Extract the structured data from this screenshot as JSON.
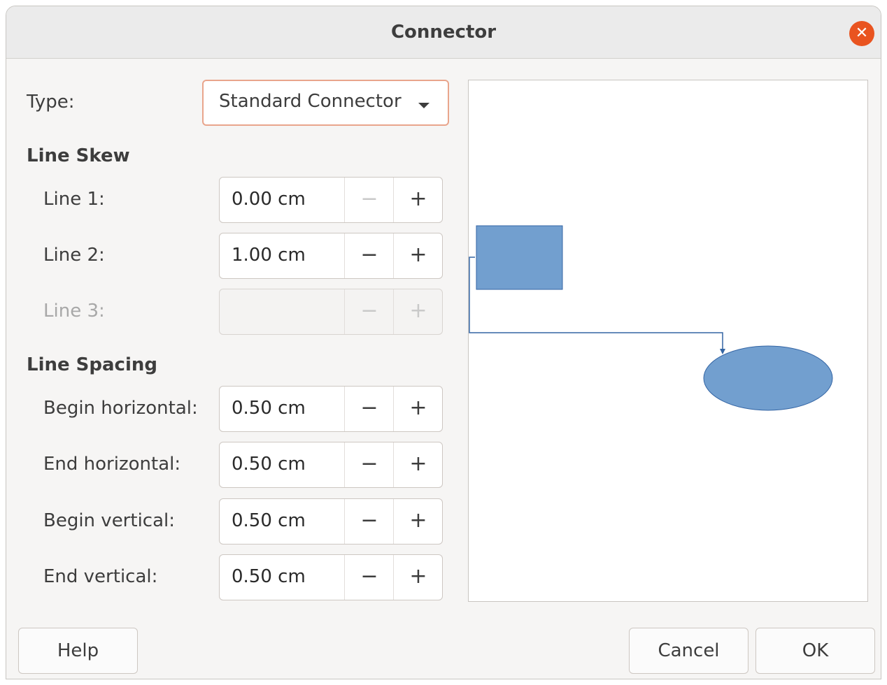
{
  "dialog": {
    "title": "Connector",
    "close_icon": "close-icon"
  },
  "type_row": {
    "label": "Type:",
    "selected": "Standard Connector"
  },
  "line_skew": {
    "heading": "Line Skew",
    "rows": [
      {
        "label": "Line 1:",
        "value": "0.00 cm",
        "enabled": true,
        "minus_enabled": false
      },
      {
        "label": "Line 2:",
        "value": "1.00 cm",
        "enabled": true,
        "minus_enabled": true
      },
      {
        "label": "Line 3:",
        "value": "",
        "enabled": false,
        "minus_enabled": false
      }
    ]
  },
  "line_spacing": {
    "heading": "Line Spacing",
    "rows": [
      {
        "label": "Begin horizontal:",
        "value": "0.50 cm"
      },
      {
        "label": "End horizontal:",
        "value": "0.50 cm"
      },
      {
        "label": "Begin vertical:",
        "value": "0.50 cm"
      },
      {
        "label": "End vertical:",
        "value": "0.50 cm"
      }
    ]
  },
  "spin_glyphs": {
    "minus": "−",
    "plus": "+"
  },
  "preview": {
    "shape_fill": "#729fcf",
    "shape_stroke": "#3465a4",
    "connector_color": "#3465a4"
  },
  "buttons": {
    "help": "Help",
    "cancel": "Cancel",
    "ok": "OK"
  }
}
